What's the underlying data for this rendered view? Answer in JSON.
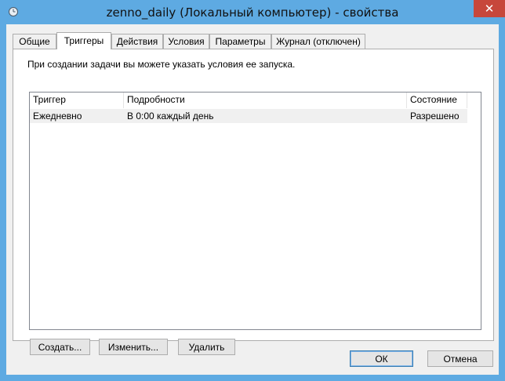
{
  "window": {
    "title": "zenno_daily (Локальный компьютер) - свойства",
    "close_label": "✕"
  },
  "tabs": [
    {
      "label": "Общие"
    },
    {
      "label": "Триггеры"
    },
    {
      "label": "Действия"
    },
    {
      "label": "Условия"
    },
    {
      "label": "Параметры"
    },
    {
      "label": "Журнал (отключен)"
    }
  ],
  "active_tab": "Триггеры",
  "panel": {
    "description": "При создании задачи вы можете указать условия ее запуска."
  },
  "list": {
    "columns": [
      "Триггер",
      "Подробности",
      "Состояние"
    ],
    "rows": [
      {
        "trigger": "Ежедневно",
        "details": "В 0:00 каждый день",
        "state": "Разрешено"
      }
    ]
  },
  "buttons": {
    "create": "Создать...",
    "edit": "Изменить...",
    "delete": "Удалить",
    "ok": "ОК",
    "cancel": "Отмена"
  },
  "colors": {
    "title_bar": "#5eaae2",
    "close_button": "#c7473b"
  }
}
